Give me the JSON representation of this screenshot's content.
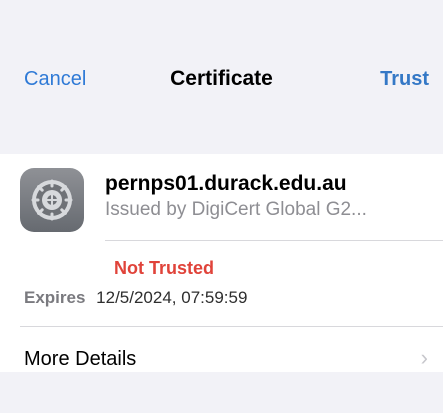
{
  "nav": {
    "cancel": "Cancel",
    "title": "Certificate",
    "trust": "Trust"
  },
  "certificate": {
    "icon": "gear-icon",
    "name": "pernps01.durack.edu.au",
    "issuer": "Issued by DigiCert Global G2...",
    "status": "Not Trusted",
    "expires_label": "Expires",
    "expires_value": "12/5/2024, 07:59:59"
  },
  "details": {
    "label": "More Details",
    "icon": "chevron-right-icon"
  },
  "colors": {
    "accent": "#3478c6",
    "warning": "#e0433a",
    "secondary_text": "#8e8e93",
    "background": "#f2f2f7"
  }
}
